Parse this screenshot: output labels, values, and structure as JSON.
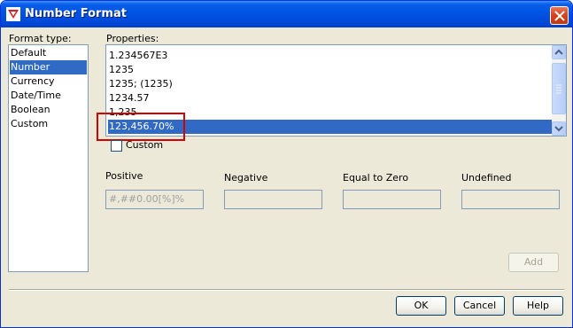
{
  "window": {
    "title": "Number Format"
  },
  "format_type": {
    "label": "Format type:",
    "items": [
      {
        "label": "Default",
        "selected": false
      },
      {
        "label": "Number",
        "selected": true
      },
      {
        "label": "Currency",
        "selected": false
      },
      {
        "label": "Date/Time",
        "selected": false
      },
      {
        "label": "Boolean",
        "selected": false
      },
      {
        "label": "Custom",
        "selected": false
      }
    ]
  },
  "properties": {
    "label": "Properties:",
    "partial_item": ".",
    "items": [
      {
        "label": "1.234567E3",
        "selected": false
      },
      {
        "label": "1235",
        "selected": false
      },
      {
        "label": "1235; (1235)",
        "selected": false
      },
      {
        "label": "1234.57",
        "selected": false
      },
      {
        "label": "1,235",
        "selected": false
      },
      {
        "label": "123,456.70%",
        "selected": true
      }
    ]
  },
  "custom": {
    "label": "Custom",
    "checked": false
  },
  "fields": {
    "positive": {
      "label": "Positive",
      "value": "#,##0.00[%]%"
    },
    "negative": {
      "label": "Negative",
      "value": ""
    },
    "equal_to_zero": {
      "label": "Equal to Zero",
      "value": ""
    },
    "undefined": {
      "label": "Undefined",
      "value": ""
    }
  },
  "buttons": {
    "add": "Add",
    "ok": "OK",
    "cancel": "Cancel",
    "help": "Help"
  },
  "colors": {
    "selection": "#316ac5",
    "title_bar": "#0055e5",
    "annotation": "#d40000"
  }
}
